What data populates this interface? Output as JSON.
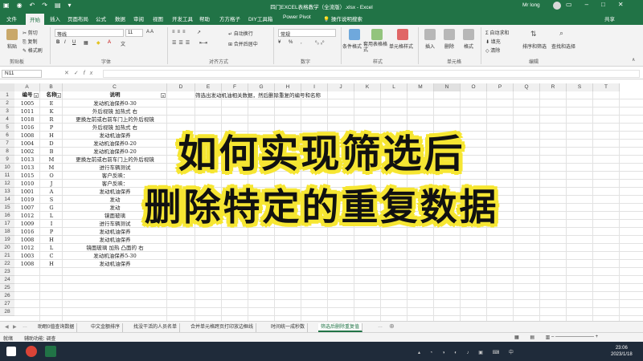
{
  "window": {
    "title": "四门EXCEL表格教学（全流版）.xlsx - Excel",
    "user": "Mr long",
    "share_label": "共享",
    "tell_me": "操作说明搜索"
  },
  "tabs": [
    "文件",
    "开始",
    "插入",
    "页面布局",
    "公式",
    "数据",
    "审阅",
    "视图",
    "开发工具",
    "帮助",
    "方方格子",
    "DIY工具箱",
    "Power Pivot"
  ],
  "ribbon": {
    "clipboard": {
      "label": "剪贴板",
      "paste": "粘贴",
      "cut": "剪切",
      "copy": "复制",
      "format_painter": "格式刷"
    },
    "font": {
      "label": "字体",
      "font_name": "等线",
      "font_size": "11"
    },
    "alignment": {
      "label": "对齐方式",
      "wrap": "自动换行",
      "merge": "合并后居中"
    },
    "number": {
      "label": "数字",
      "format": "常规"
    },
    "styles": {
      "label": "样式",
      "conditional": "条件格式",
      "table": "套用表格格式",
      "cell_styles": "单元格样式"
    },
    "cells": {
      "label": "单元格",
      "insert": "插入",
      "delete": "删除",
      "format": "格式"
    },
    "editing": {
      "label": "编辑",
      "autosum": "自动求和",
      "fill": "填充",
      "clear": "清除",
      "sort": "排序和筛选",
      "find": "查找和选择"
    }
  },
  "formula_bar": {
    "name_box": "N11",
    "content": ""
  },
  "columns": [
    "A",
    "B",
    "C",
    "D",
    "E",
    "F",
    "G",
    "H",
    "I",
    "J",
    "K",
    "L",
    "M",
    "N",
    "O",
    "P",
    "Q",
    "R",
    "S",
    "T"
  ],
  "rows": [
    "1",
    "2",
    "3",
    "4",
    "5",
    "6",
    "7",
    "8",
    "9",
    "10",
    "11",
    "12",
    "13",
    "14",
    "15",
    "16",
    "17",
    "18",
    "19",
    "20",
    "21",
    "22",
    "23",
    "24",
    "25",
    "26",
    "27",
    "28"
  ],
  "table": {
    "headers": [
      "编号",
      "名称",
      "说明"
    ],
    "rows": [
      [
        "1005",
        "E",
        "发动机油保养0-30"
      ],
      [
        "1011",
        "K",
        "外后视镜 加热式 右"
      ],
      [
        "1018",
        "R",
        "更换左前或右前车门上的外后视镜"
      ],
      [
        "1016",
        "P",
        "外后视镜 加热式 右"
      ],
      [
        "1008",
        "H",
        "发动机油保养"
      ],
      [
        "1004",
        "D",
        "发动机油保养0-20"
      ],
      [
        "1002",
        "B",
        "发动机油保养0-20"
      ],
      [
        "1013",
        "M",
        "更换左前或右前车门上的外后视镜"
      ],
      [
        "1013",
        "M",
        "进行车辆测试"
      ],
      [
        "1015",
        "O",
        "客户反映："
      ],
      [
        "1010",
        "J",
        "客户反映："
      ],
      [
        "1001",
        "A",
        "发动机油保养"
      ],
      [
        "1019",
        "S",
        "发动"
      ],
      [
        "1007",
        "G",
        "发动"
      ],
      [
        "1012",
        "L",
        "镜面玻璃"
      ],
      [
        "1009",
        "I",
        "进行车辆测试"
      ],
      [
        "1016",
        "P",
        "发动机油保养"
      ],
      [
        "1008",
        "H",
        "发动机油保养"
      ],
      [
        "1012",
        "L",
        "镜面玻璃 加热 凸面的 右"
      ],
      [
        "1003",
        "C",
        "发动机油保养5-30"
      ],
      [
        "1008",
        "H",
        "发动机油保养"
      ]
    ]
  },
  "note": "筛选出发动机油相关数据，然后删除重复的编号和名称",
  "overlay": {
    "line1": "如何实现筛选后",
    "line2": "删除特定的重复数据"
  },
  "sheet_tabs": [
    "助眠0值查询数据",
    "中文金额排序",
    "找没干活的人员名单",
    "合并单元格跨页打印放边框线",
    "时间统一成秒数",
    "筛选后删除重复值"
  ],
  "status": {
    "mode": "就绪",
    "accessibility": "辅助功能: 调查"
  },
  "clock": {
    "time": "23:06",
    "date": "2023/1/18"
  }
}
